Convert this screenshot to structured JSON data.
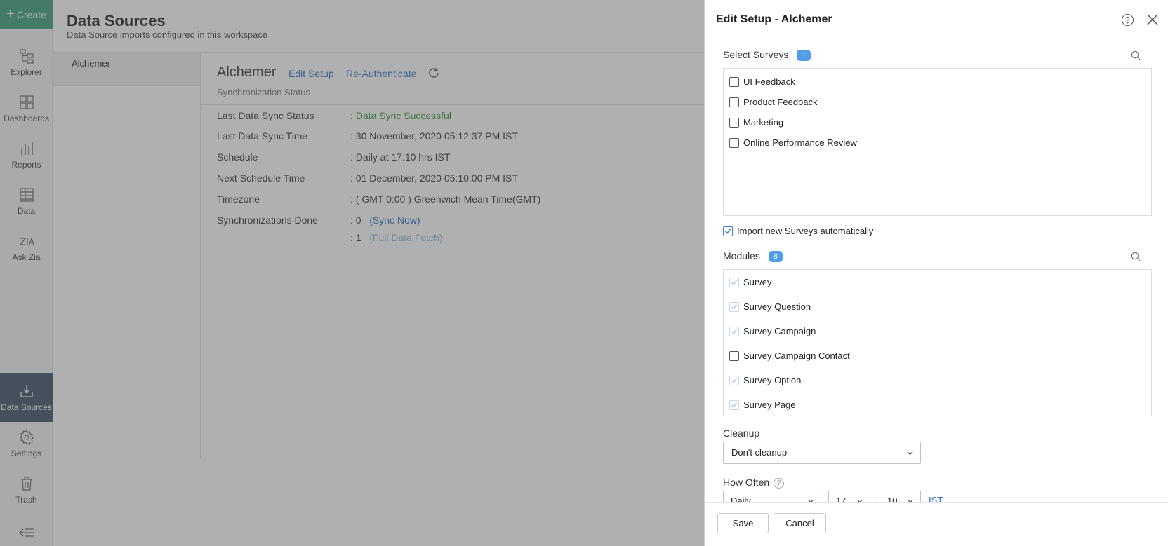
{
  "rail": {
    "create_label": "Create",
    "items": [
      {
        "label": "Explorer",
        "icon": "explorer-icon"
      },
      {
        "label": "Dashboards",
        "icon": "dashboards-icon"
      },
      {
        "label": "Reports",
        "icon": "reports-icon"
      },
      {
        "label": "Data",
        "icon": "data-icon"
      },
      {
        "label": "Ask Zia",
        "icon": "ask-zia-icon"
      },
      {
        "label": "Data Sources",
        "icon": "data-sources-icon",
        "active": true
      },
      {
        "label": "Settings",
        "icon": "gear-icon"
      },
      {
        "label": "Trash",
        "icon": "trash-icon"
      }
    ]
  },
  "page": {
    "title": "Data Sources",
    "subtitle": "Data Source imports configured in this workspace"
  },
  "sources": [
    "Alchemer"
  ],
  "detail": {
    "name": "Alchemer",
    "edit_setup": "Edit Setup",
    "reauth": "Re-Authenticate",
    "sync_status_label": "Synchronization Status",
    "rows": [
      {
        "label": "Last Data Sync Status",
        "value": ": ",
        "value_colored": "Data Sync Successful"
      },
      {
        "label": "Last Data Sync Time",
        "value": ": 30 November, 2020 05:12:37 PM IST"
      },
      {
        "label": "Schedule",
        "value": ": Daily at 17:10 hrs IST"
      },
      {
        "label": "Next Schedule Time",
        "value": ": 01 December, 2020 05:10:00 PM IST"
      },
      {
        "label": "Timezone",
        "value": ": ( GMT 0:00 ) Greenwich Mean Time(GMT)"
      },
      {
        "label": "Synchronizations Done",
        "value": ": 0",
        "link": "(Sync Now)"
      }
    ],
    "extra_row": {
      "value": ": 1",
      "link": "(Full Data Fetch)"
    }
  },
  "panel": {
    "title": "Edit Setup - Alchemer",
    "surveys_label": "Select Surveys",
    "surveys_count": "1",
    "surveys": [
      {
        "label": "UI Feedback",
        "checked": false
      },
      {
        "label": "Product Feedback",
        "checked": false
      },
      {
        "label": "Marketing",
        "checked": false
      },
      {
        "label": "Online Performance Review",
        "checked": false
      }
    ],
    "import_new_label": "Import new Surveys automatically",
    "import_new_checked": true,
    "modules_label": "Modules",
    "modules_count": "8",
    "modules": [
      {
        "label": "Survey",
        "state": "disabled-checked"
      },
      {
        "label": "Survey Question",
        "state": "disabled-checked"
      },
      {
        "label": "Survey Campaign",
        "state": "disabled-checked"
      },
      {
        "label": "Survey Campaign Contact",
        "state": "unchecked"
      },
      {
        "label": "Survey Option",
        "state": "disabled-checked"
      },
      {
        "label": "Survey Page",
        "state": "disabled-checked"
      }
    ],
    "cleanup_label": "Cleanup",
    "cleanup_value": "Don't cleanup",
    "how_often_label": "How Often",
    "frequency_value": "Daily",
    "hour_value": "17",
    "minute_value": "10",
    "timezone_link": "IST",
    "save_label": "Save",
    "cancel_label": "Cancel"
  },
  "colors": {
    "create": "#3a9f79",
    "active_rail": "#3d5166",
    "link": "#2b6ebf",
    "success": "#2c8c2c",
    "badge": "#4f9de6"
  }
}
